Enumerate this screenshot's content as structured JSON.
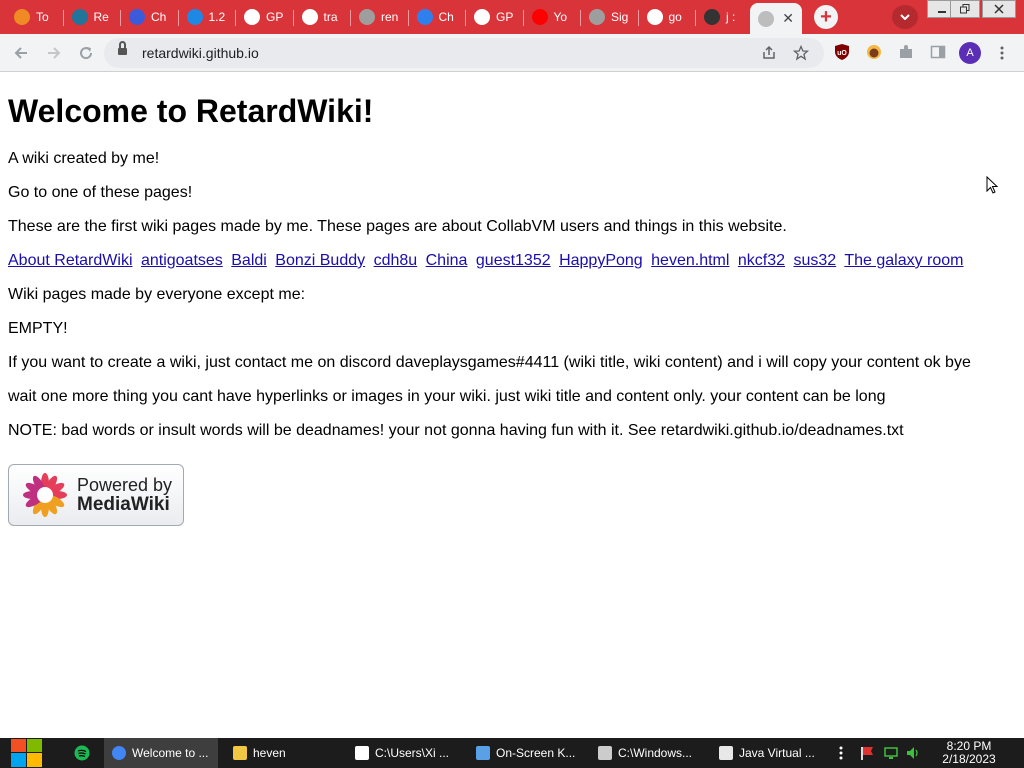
{
  "browser": {
    "tabs": [
      {
        "label": "To",
        "icon": "orange-circle-icon",
        "color": "#f08a24"
      },
      {
        "label": "Re",
        "icon": "wordpress-icon",
        "color": "#21759b"
      },
      {
        "label": "Ch",
        "icon": "a-logo-icon",
        "color": "#3b5bdb"
      },
      {
        "label": "1.2",
        "icon": "blue-swoosh-icon",
        "color": "#1e88e5"
      },
      {
        "label": "GP",
        "icon": "gmail-icon",
        "color": "#ffffff"
      },
      {
        "label": "tra",
        "icon": "google-icon",
        "color": "#ffffff"
      },
      {
        "label": "ren",
        "icon": "globe-icon",
        "color": "#9e9e9e"
      },
      {
        "label": "Ch",
        "icon": "puzzle-icon",
        "color": "#2f80ed"
      },
      {
        "label": "GP",
        "icon": "google-g-icon",
        "color": "#ffffff"
      },
      {
        "label": "Yo",
        "icon": "youtube-icon",
        "color": "#ff0000"
      },
      {
        "label": "Sig",
        "icon": "globe-icon",
        "color": "#9e9e9e"
      },
      {
        "label": "go",
        "icon": "flag-uk-icon",
        "color": "#ffffff"
      },
      {
        "label": "j :",
        "icon": "avatar-icon",
        "color": "#333333"
      }
    ],
    "active_tab": {
      "icon": "globe-icon",
      "close": "✕"
    },
    "new_tab": "+",
    "url": "retardwiki.github.io"
  },
  "page": {
    "title": "Welcome to RetardWiki!",
    "intro": "A wiki created by me!",
    "goto": "Go to one of these pages!",
    "first_pages": "These are the first wiki pages made by me. These pages are about CollabVM users and things in this website.",
    "links": [
      "About RetardWiki",
      "antigoatses",
      "Baldi",
      "Bonzi Buddy",
      "cdh8u",
      "China",
      "guest1352",
      "HappyPong",
      "heven.html",
      "nkcf32",
      "sus32",
      "The galaxy room"
    ],
    "everyone_heading": "Wiki pages made by everyone except me:",
    "empty": "EMPTY!",
    "create_info": "If you want to create a wiki, just contact me on discord daveplaysgames#4411 (wiki title, wiki content) and i will copy your content ok bye",
    "one_more": "wait one more thing you cant have hyperlinks or images in your wiki. just wiki title and content only. your content can be long",
    "note": "NOTE: bad words or insult words will be deadnames! your not gonna having fun with it. See retardwiki.github.io/deadnames.txt",
    "badge_top": "Powered by",
    "badge_bottom": "MediaWiki"
  },
  "profile_initial": "A",
  "taskbar": {
    "tasks": [
      {
        "label": "Welcome to ...",
        "icon": "chrome-icon",
        "color": "#4285f4",
        "active": true
      },
      {
        "label": "heven",
        "icon": "folder-icon",
        "color": "#f2c744",
        "active": false
      },
      {
        "label": "C:\\Users\\Xi ...",
        "icon": "7zip-icon",
        "color": "#ffffff",
        "active": false
      },
      {
        "label": "On-Screen K...",
        "icon": "keyboard-icon",
        "color": "#5aa0e6",
        "active": false
      },
      {
        "label": "C:\\Windows...",
        "icon": "console-icon",
        "color": "#cccccc",
        "active": false
      },
      {
        "label": "Java Virtual ...",
        "icon": "java-icon",
        "color": "#e8e8e8",
        "active": false
      }
    ],
    "time": "8:20 PM",
    "date": "2/18/2023"
  }
}
